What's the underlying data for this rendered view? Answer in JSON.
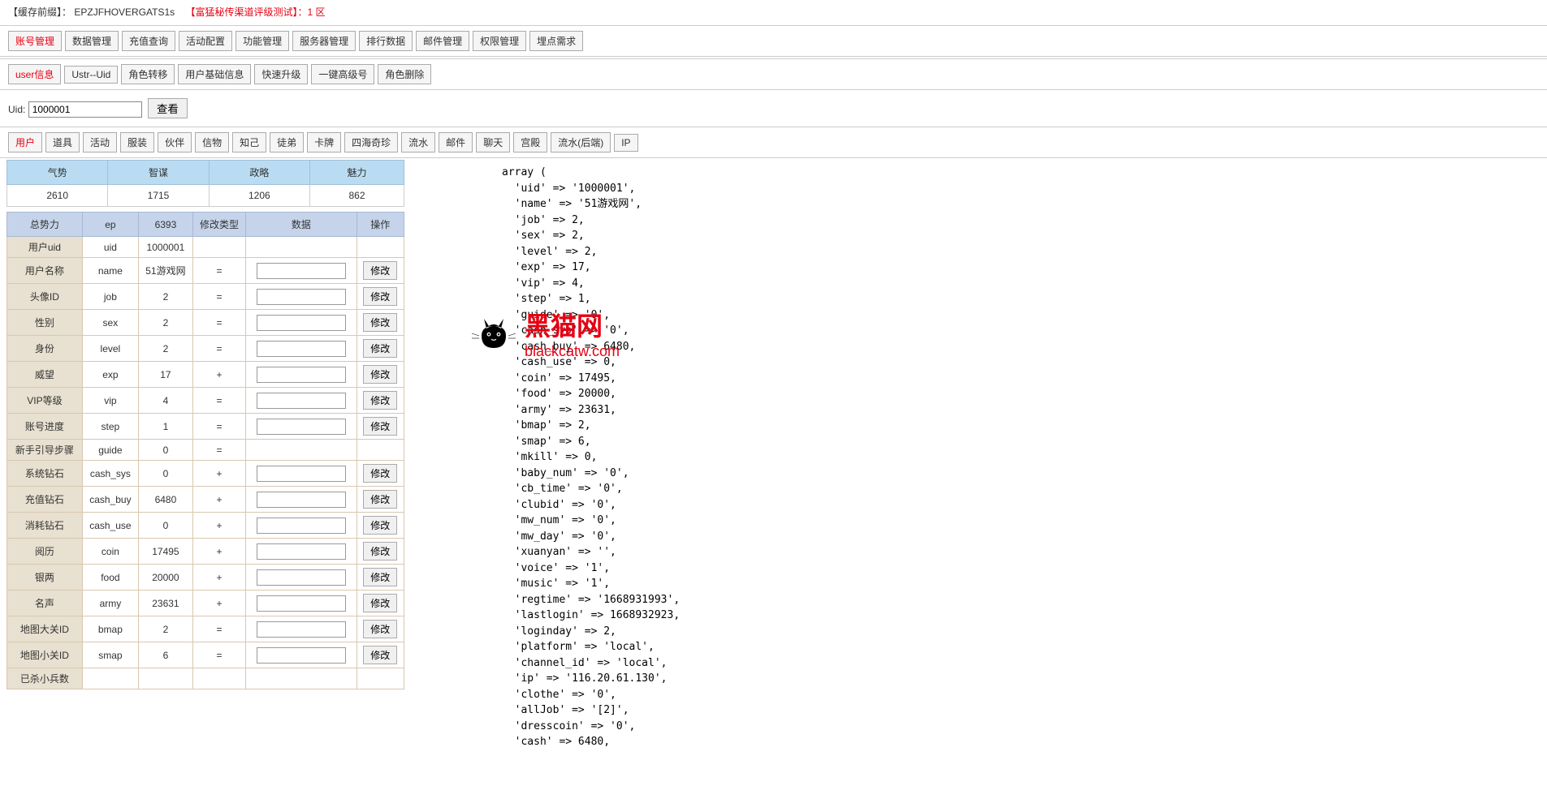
{
  "header": {
    "prefix_label": "【缓存前缀】：",
    "prefix_value": "EPZJFHOVERGATS1s",
    "zone_label": "【富猛秘传渠道评级测试】：1 区"
  },
  "main_tabs": [
    "账号管理",
    "数据管理",
    "充值查询",
    "活动配置",
    "功能管理",
    "服务器管理",
    "排行数据",
    "邮件管理",
    "权限管理",
    "埋点需求"
  ],
  "main_tabs_active": 0,
  "sub_tabs": [
    "user信息",
    "Ustr--Uid",
    "角色转移",
    "用户基础信息",
    "快速升级",
    "一键高级号",
    "角色删除"
  ],
  "sub_tabs_active": 0,
  "uid_form": {
    "label": "Uid:",
    "value": "1000001",
    "button": "查看"
  },
  "detail_tabs": [
    "用户",
    "道具",
    "活动",
    "服装",
    "伙伴",
    "信物",
    "知己",
    "徒弟",
    "卡牌",
    "四海奇珍",
    "流水",
    "邮件",
    "聊天",
    "宫殿",
    "流水(后端)",
    "IP"
  ],
  "detail_tabs_active": 0,
  "stats": {
    "headers": [
      "气势",
      "智谋",
      "政略",
      "魅力"
    ],
    "values": [
      "2610",
      "1715",
      "1206",
      "862"
    ]
  },
  "table": {
    "headers": [
      "总势力",
      "ep",
      "6393",
      "修改类型",
      "数据",
      "操作"
    ],
    "modify_label": "修改",
    "rows": [
      {
        "label": "用户uid",
        "key": "uid",
        "val": "1000001",
        "op": "",
        "input": false,
        "btn": false
      },
      {
        "label": "用户名称",
        "key": "name",
        "val": "51游戏网",
        "op": "=",
        "input": true,
        "btn": true
      },
      {
        "label": "头像ID",
        "key": "job",
        "val": "2",
        "op": "=",
        "input": true,
        "btn": true
      },
      {
        "label": "性别",
        "key": "sex",
        "val": "2",
        "op": "=",
        "input": true,
        "btn": true
      },
      {
        "label": "身份",
        "key": "level",
        "val": "2",
        "op": "=",
        "input": true,
        "btn": true
      },
      {
        "label": "威望",
        "key": "exp",
        "val": "17",
        "op": "+",
        "input": true,
        "btn": true
      },
      {
        "label": "VIP等级",
        "key": "vip",
        "val": "4",
        "op": "=",
        "input": true,
        "btn": true
      },
      {
        "label": "账号进度",
        "key": "step",
        "val": "1",
        "op": "=",
        "input": true,
        "btn": true
      },
      {
        "label": "新手引导步骤",
        "key": "guide",
        "val": "0",
        "op": "=",
        "input": false,
        "btn": false
      },
      {
        "label": "系统钻石",
        "key": "cash_sys",
        "val": "0",
        "op": "+",
        "input": true,
        "btn": true
      },
      {
        "label": "充值钻石",
        "key": "cash_buy",
        "val": "6480",
        "op": "+",
        "input": true,
        "btn": true
      },
      {
        "label": "消耗钻石",
        "key": "cash_use",
        "val": "0",
        "op": "+",
        "input": true,
        "btn": true
      },
      {
        "label": "阅历",
        "key": "coin",
        "val": "17495",
        "op": "+",
        "input": true,
        "btn": true
      },
      {
        "label": "银两",
        "key": "food",
        "val": "20000",
        "op": "+",
        "input": true,
        "btn": true
      },
      {
        "label": "名声",
        "key": "army",
        "val": "23631",
        "op": "+",
        "input": true,
        "btn": true
      },
      {
        "label": "地图大关ID",
        "key": "bmap",
        "val": "2",
        "op": "=",
        "input": true,
        "btn": true
      },
      {
        "label": "地图小关ID",
        "key": "smap",
        "val": "6",
        "op": "=",
        "input": true,
        "btn": true
      },
      {
        "label": "已杀小兵数",
        "key": "",
        "val": "",
        "op": "",
        "input": false,
        "btn": false
      }
    ]
  },
  "dump_lines": [
    "array (",
    "  'uid' => '1000001',",
    "  'name' => '51游戏网',",
    "  'job' => 2,",
    "  'sex' => 2,",
    "  'level' => 2,",
    "  'exp' => 17,",
    "  'vip' => 4,",
    "  'step' => 1,",
    "  'guide' => '0',",
    "  'cash_sys' => '0',",
    "  'cash_buy' => 6480,",
    "  'cash_use' => 0,",
    "  'coin' => 17495,",
    "  'food' => 20000,",
    "  'army' => 23631,",
    "  'bmap' => 2,",
    "  'smap' => 6,",
    "  'mkill' => 0,",
    "  'baby_num' => '0',",
    "  'cb_time' => '0',",
    "  'clubid' => '0',",
    "  'mw_num' => '0',",
    "  'mw_day' => '0',",
    "  'xuanyan' => '',",
    "  'voice' => '1',",
    "  'music' => '1',",
    "  'regtime' => '1668931993',",
    "  'lastlogin' => 1668932923,",
    "  'loginday' => 2,",
    "  'platform' => 'local',",
    "  'channel_id' => 'local',",
    "  'ip' => '116.20.61.130',",
    "  'clothe' => '0',",
    "  'allJob' => '[2]',",
    "  'dresscoin' => '0',",
    "  'cash' => 6480,"
  ],
  "watermark": {
    "cn": "黑猫网",
    "en": "blackcatw.com"
  }
}
